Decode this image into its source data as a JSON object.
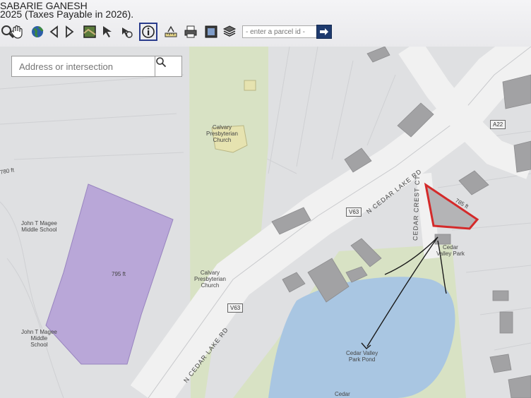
{
  "header": {
    "owner_name": "SABARIE GANESH",
    "tax_year": "2025 (Taxes Payable in 2026)."
  },
  "toolbar": {
    "tools": [
      {
        "id": "zoom-in",
        "icon": "zoom-in-icon"
      },
      {
        "id": "pan",
        "icon": "hand-icon"
      },
      {
        "id": "full-extent",
        "icon": "globe-icon"
      },
      {
        "id": "previous-extent",
        "icon": "arrow-left-icon"
      },
      {
        "id": "next-extent",
        "icon": "arrow-right-icon"
      },
      {
        "id": "aerial",
        "icon": "aerial-photo-icon"
      },
      {
        "id": "select",
        "icon": "select-arrow-icon"
      },
      {
        "id": "buffer",
        "icon": "buffer-icon"
      },
      {
        "id": "identify",
        "icon": "info-icon"
      },
      {
        "id": "measure",
        "icon": "measure-icon"
      },
      {
        "id": "print",
        "icon": "print-icon"
      },
      {
        "id": "export",
        "icon": "export-icon"
      },
      {
        "id": "layers",
        "icon": "layers-icon"
      }
    ],
    "parcel_placeholder": "- enter a parcel id -",
    "go_icon": "arrow-right-icon",
    "active_tool": "identify"
  },
  "search": {
    "placeholder": "Address or intersection",
    "button_icon": "search-icon"
  },
  "map": {
    "labels": {
      "church_top": [
        "Calvary",
        "Presbyterian",
        "Church"
      ],
      "church_bottom": [
        "Calvary",
        "Presbyterian",
        "Church"
      ],
      "school_top": [
        "John T Magee",
        "Middle School"
      ],
      "school_bottom": [
        "John T Magee",
        "Middle",
        "School"
      ],
      "elevation_school": "795 ft",
      "elevation_left": "780 ft",
      "elevation_parcel": "785 ft",
      "road_upper": "N CEDAR LAKE RD",
      "road_lower": "N CEDAR LAKE RD",
      "road_crest": "CEDAR CREST CT",
      "park": [
        "Cedar",
        "Valley Park"
      ],
      "pond": [
        "Cedar Valley",
        "Park Pond"
      ],
      "pond_bottom": "Cedar",
      "shield_upper": "V63",
      "shield_lower": "V63",
      "shield_a22": "A22"
    },
    "colors": {
      "background": "#dfe0e2",
      "park": "#d8e2c4",
      "pond": "#a9c6e2",
      "school": "#b9a7d8",
      "church": "#e6e3b0",
      "building": "#a2a2a4",
      "selected_parcel": "#d42a2a"
    }
  }
}
